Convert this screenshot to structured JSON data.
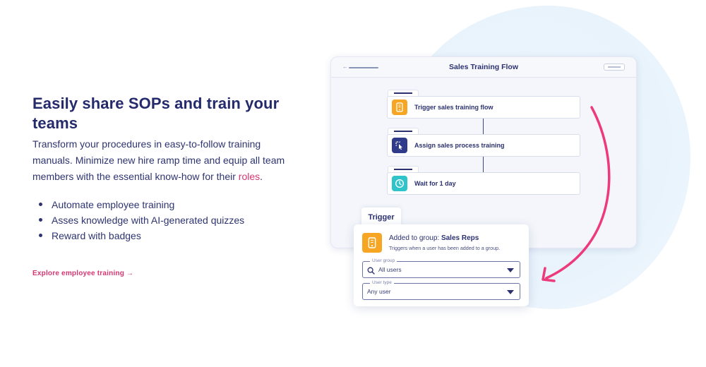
{
  "hero": {
    "headline": "Easily share SOPs and train your teams",
    "body_main": "Transform your procedures in easy-to-follow training manuals. Minimize new hire ramp time and equip all team members with the essential know-how for their ",
    "body_accent": "roles",
    "body_end": ".",
    "bullets": [
      "Automate employee training",
      "Asses knowledge with AI-generated quizzes",
      "Reward with badges"
    ],
    "cta_label": "Explore employee training →"
  },
  "flow_window": {
    "title": "Sales Training Flow",
    "back_glyph": "←",
    "steps": [
      {
        "label": "Trigger sales training flow",
        "icon": "phone-icon",
        "color": "#f6a623"
      },
      {
        "label": "Assign sales process training",
        "icon": "cursor-click-icon",
        "color": "#2f3a8a"
      },
      {
        "label": "Wait for 1 day",
        "icon": "clock-icon",
        "color": "#2ec4c9"
      }
    ]
  },
  "trigger_panel": {
    "tab_label": "Trigger",
    "title_prefix": "Added to group: ",
    "title_bold": "Sales Reps",
    "subtitle": "Triggers when a user has been added to a group.",
    "user_group": {
      "legend": "User group",
      "value": "All users"
    },
    "user_type": {
      "legend": "User type",
      "value": "Any user"
    }
  },
  "colors": {
    "accent": "#d6366f",
    "navy": "#242a6b",
    "arrow": "#ec3a7c"
  }
}
